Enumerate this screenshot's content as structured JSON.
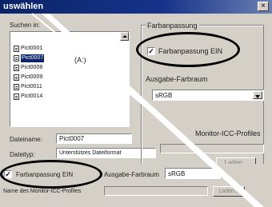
{
  "window": {
    "title": "uswählen",
    "close": "×"
  },
  "left": {
    "search_label": "Suchen in:",
    "path_hint": "(A:)",
    "files": [
      "Pict0001",
      "Pict0007",
      "Pict0008",
      "Pict0009",
      "Pict0011",
      "Pict0014"
    ],
    "selected_index": 1,
    "filename_label": "Dateiname:",
    "filename_value": "Pict0007",
    "filetype_label": "Dateityp:",
    "filetype_value": "Unterstützes Dateiformat"
  },
  "right": {
    "group_title": "Farbanpassung",
    "check_label": "Farbanpassung EIN",
    "check_mark": "✓",
    "output_label": "Ausgabe-Farbraum",
    "output_value": "sRGB",
    "monitor_label": "Monitor-ICC-Profiles",
    "load_button": "Laden..."
  },
  "bottom": {
    "check_label": "Farbanpassung EIN",
    "check_mark": "✓",
    "output_label": "Ausgabe-Farbraum",
    "output_value": "sRGB",
    "profile_label": "Name des Monitor-ICC-Profiles",
    "load_button": "Laden..."
  }
}
